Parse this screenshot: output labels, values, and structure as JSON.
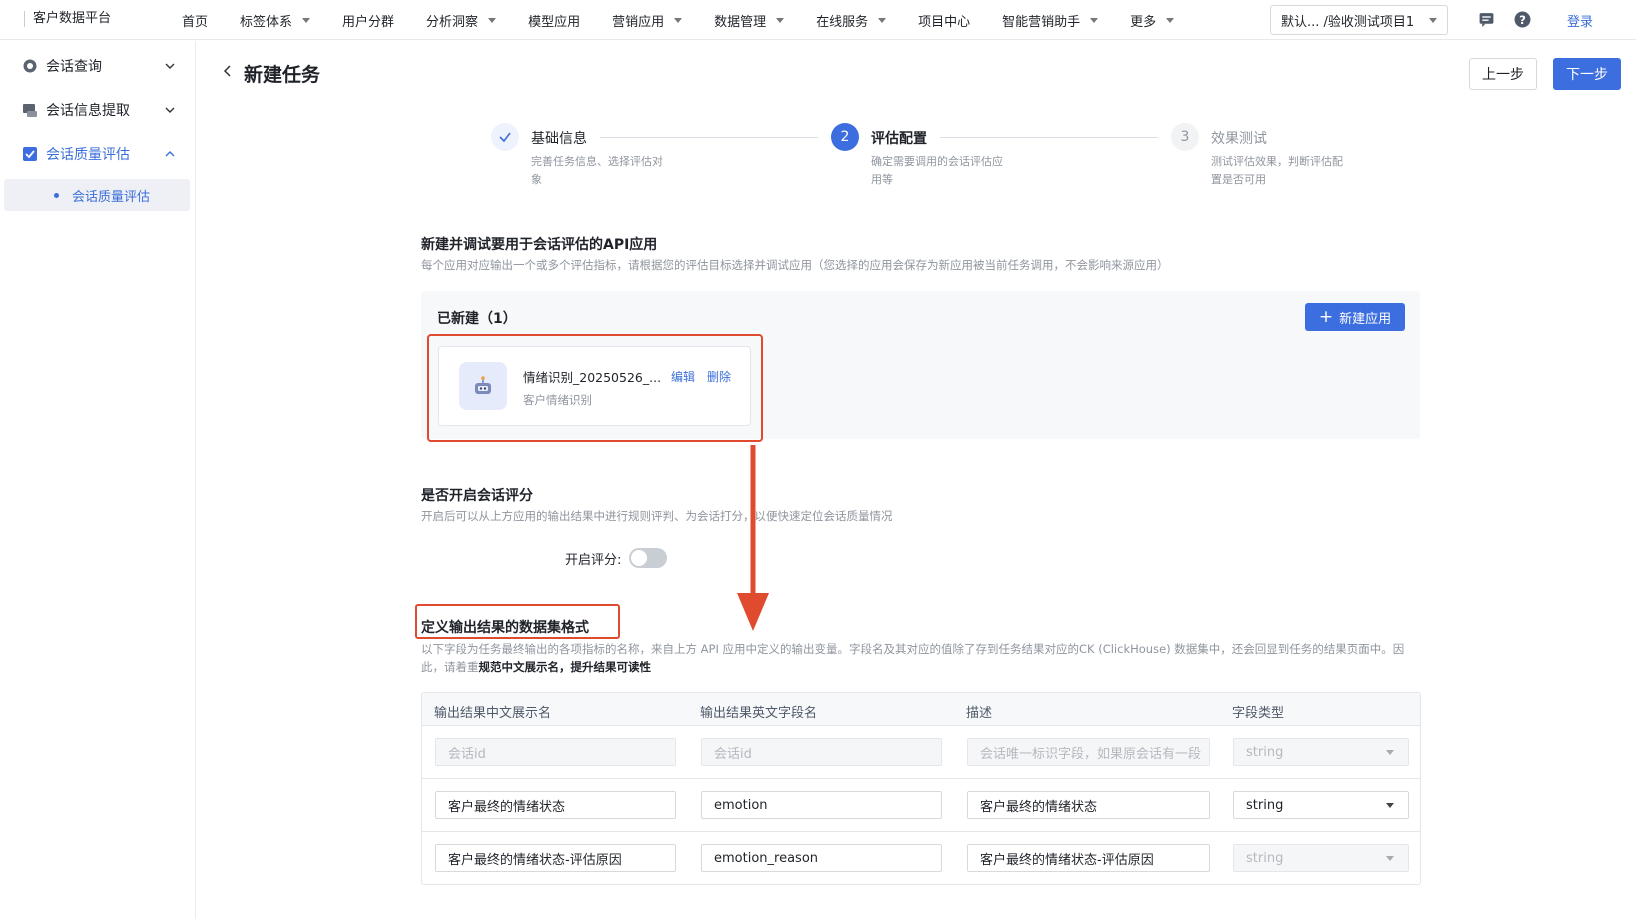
{
  "app": {
    "brand": "客户数据平台"
  },
  "nav": {
    "items": [
      {
        "label": "首页",
        "dropdown": false
      },
      {
        "label": "标签体系",
        "dropdown": true
      },
      {
        "label": "用户分群",
        "dropdown": false
      },
      {
        "label": "分析洞察",
        "dropdown": true
      },
      {
        "label": "模型应用",
        "dropdown": false
      },
      {
        "label": "营销应用",
        "dropdown": true
      },
      {
        "label": "数据管理",
        "dropdown": true
      },
      {
        "label": "在线服务",
        "dropdown": true
      },
      {
        "label": "项目中心",
        "dropdown": false
      },
      {
        "label": "智能营销助手",
        "dropdown": true
      },
      {
        "label": "更多",
        "dropdown": true
      }
    ],
    "project": "默认...   /验收测试项目1",
    "login": "登录"
  },
  "sidebar": {
    "items": [
      {
        "label": "会话查询"
      },
      {
        "label": "会话信息提取"
      },
      {
        "label": "会话质量评估"
      }
    ],
    "sub_item": "会话质量评估"
  },
  "header": {
    "title": "新建任务",
    "prev": "上一步",
    "next": "下一步"
  },
  "steps": [
    {
      "index": "1",
      "title": "基础信息",
      "desc": "完善任务信息、选择评估对象",
      "status": "done"
    },
    {
      "index": "2",
      "title": "评估配置",
      "desc": "确定需要调用的会话评估应用等",
      "status": "active"
    },
    {
      "index": "3",
      "title": "效果测试",
      "desc": "测试评估效果，判断评估配置是否可用",
      "status": "wait"
    }
  ],
  "section_app": {
    "title": "新建并调试要用于会话评估的API应用",
    "desc": "每个应用对应输出一个或多个评估指标，请根据您的评估目标选择并调试应用（您选择的应用会保存为新应用被当前任务调用，不会影响来源应用）",
    "created_label": "已新建（1）",
    "new_button": "新建应用",
    "card": {
      "name": "情绪识别_20250526_...",
      "sub": "客户情绪识别",
      "edit": "编辑",
      "delete": "删除"
    }
  },
  "section_score": {
    "title": "是否开启会话评分",
    "desc": "开启后可以从上方应用的输出结果中进行规则评判、为会话打分，以便快速定位会话质量情况",
    "switch_label": "开启评分:",
    "enabled": false
  },
  "section_output": {
    "title": "定义输出结果的数据集格式",
    "desc": "以下字段为任务最终输出的各项指标的名称，来自上方 API 应用中定义的输出变量。字段名及其对应的值除了存到任务结果对应的CK (ClickHouse) 数据集中，还会回显到任务的结果页面中。因此，请着重",
    "desc_bold": "规范中文展示名，提升结果可读性",
    "columns": [
      "输出结果中文展示名",
      "输出结果英文字段名",
      "描述",
      "字段类型"
    ],
    "rows": [
      {
        "cn": "会话id",
        "en": "会话id",
        "desc": "会话唯一标识字段，如果原会话有一段",
        "type": "string",
        "disabled": true
      },
      {
        "cn": "客户最终的情绪状态",
        "en": "emotion",
        "desc": "客户最终的情绪状态",
        "type": "string",
        "disabled": false
      },
      {
        "cn": "客户最终的情绪状态-评估原因",
        "en": "emotion_reason",
        "desc": "客户最终的情绪状态-评估原因",
        "type": "string",
        "disabled": false,
        "type_disabled": true
      }
    ]
  }
}
